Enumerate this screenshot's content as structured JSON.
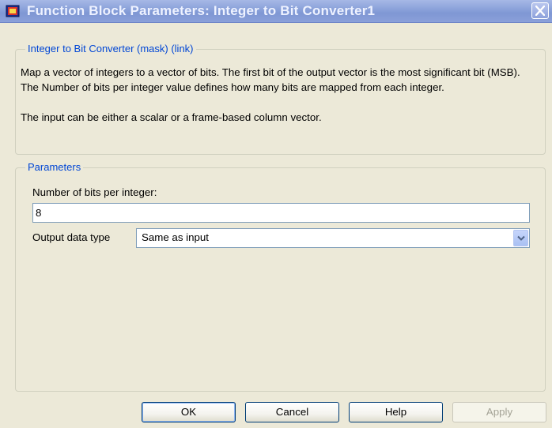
{
  "window": {
    "title": "Function Block Parameters: Integer to Bit Converter1",
    "icon": "simulink-block-icon",
    "close_icon": "close-icon"
  },
  "description_group": {
    "legend": "Integer to Bit Converter (mask) (link)",
    "paragraph1": "Map a vector of integers to a vector of bits. The first bit of the output vector is the most significant bit (MSB). The Number of bits per integer value defines how many bits are mapped from each integer.",
    "paragraph2": "The input can be either a scalar or a frame-based column vector."
  },
  "parameters_group": {
    "legend": "Parameters",
    "bits_label": "Number of bits per integer:",
    "bits_value": "8",
    "output_type_label": "Output data type",
    "output_type_value": "Same as input"
  },
  "buttons": {
    "ok": "OK",
    "cancel": "Cancel",
    "help": "Help",
    "apply": "Apply"
  }
}
